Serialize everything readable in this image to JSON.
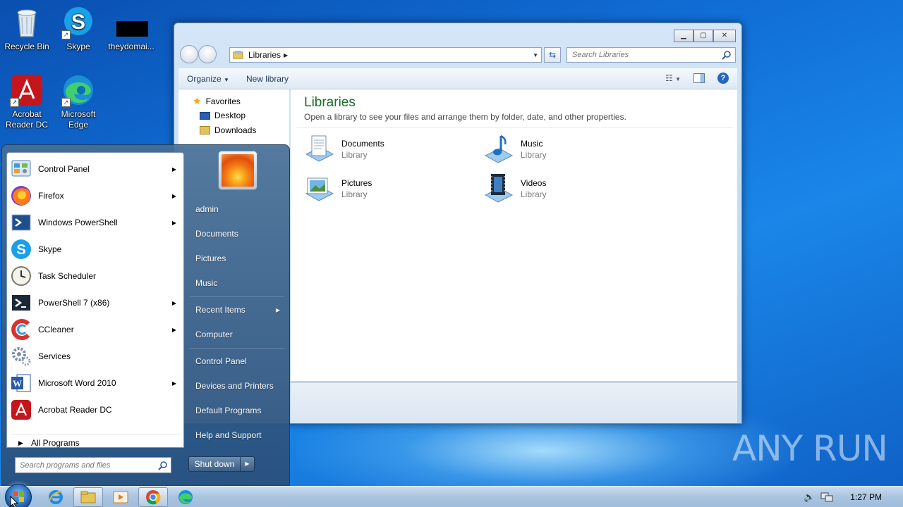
{
  "desktop": {
    "icons": [
      {
        "label": "Recycle Bin",
        "icon": "recycle-bin-icon"
      },
      {
        "label": "Skype",
        "icon": "skype-icon"
      },
      {
        "label": "theydomai...",
        "icon": "file-icon"
      },
      {
        "label": "Acrobat Reader DC",
        "icon": "acrobat-icon"
      },
      {
        "label": "Microsoft Edge",
        "icon": "edge-icon"
      }
    ],
    "watermark": "ANY RUN"
  },
  "explorer": {
    "breadcrumb": "Libraries",
    "search_placeholder": "Search Libraries",
    "toolbar": {
      "organize": "Organize",
      "new_library": "New library"
    },
    "nav": {
      "favorites": "Favorites",
      "desktop": "Desktop",
      "downloads": "Downloads"
    },
    "heading": "Libraries",
    "subheading": "Open a library to see your files and arrange them by folder, date, and other properties.",
    "libraries": [
      {
        "name": "Documents",
        "type": "Library"
      },
      {
        "name": "Music",
        "type": "Library"
      },
      {
        "name": "Pictures",
        "type": "Library"
      },
      {
        "name": "Videos",
        "type": "Library"
      }
    ]
  },
  "start_menu": {
    "programs": [
      {
        "label": "Control Panel",
        "submenu": true
      },
      {
        "label": "Firefox",
        "submenu": true
      },
      {
        "label": "Windows PowerShell",
        "submenu": true
      },
      {
        "label": "Skype",
        "submenu": false
      },
      {
        "label": "Task Scheduler",
        "submenu": false
      },
      {
        "label": "PowerShell 7 (x86)",
        "submenu": true
      },
      {
        "label": "CCleaner",
        "submenu": true
      },
      {
        "label": "Services",
        "submenu": false
      },
      {
        "label": "Microsoft Word 2010",
        "submenu": true
      },
      {
        "label": "Acrobat Reader DC",
        "submenu": false
      }
    ],
    "all_programs": "All Programs",
    "search_placeholder": "Search programs and files",
    "user": "admin",
    "right_items": [
      "Documents",
      "Pictures",
      "Music",
      "Recent Items",
      "Computer",
      "Control Panel",
      "Devices and Printers",
      "Default Programs",
      "Help and Support"
    ],
    "shutdown": "Shut down"
  },
  "taskbar": {
    "clock": "1:27 PM"
  }
}
